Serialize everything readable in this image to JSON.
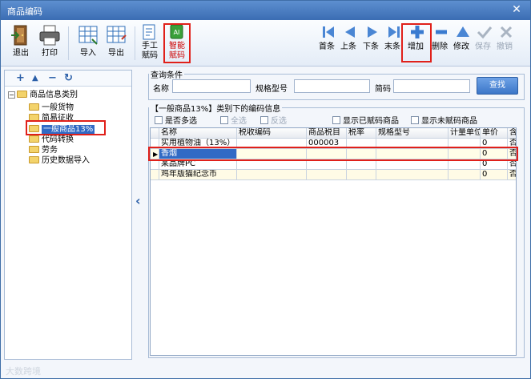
{
  "window": {
    "title": "商品编码",
    "close": "✕"
  },
  "toolbar": {
    "left": [
      {
        "label": "退出",
        "icon": "exit-door-icon"
      },
      {
        "label": "打印",
        "icon": "printer-icon"
      },
      {
        "label": "导入",
        "icon": "import-grid-icon"
      },
      {
        "label": "导出",
        "icon": "export-grid-icon"
      },
      {
        "label": "手工赋码",
        "icon": "manual-code-icon"
      },
      {
        "label": "智能赋码",
        "icon": "smart-code-icon"
      }
    ],
    "right": [
      {
        "label": "首条",
        "icon": "first-record-icon",
        "enabled": true
      },
      {
        "label": "上条",
        "icon": "prev-record-icon",
        "enabled": true
      },
      {
        "label": "下条",
        "icon": "next-record-icon",
        "enabled": true
      },
      {
        "label": "末条",
        "icon": "last-record-icon",
        "enabled": true
      },
      {
        "label": "增加",
        "icon": "plus-icon",
        "enabled": true
      },
      {
        "label": "删除",
        "icon": "minus-icon",
        "enabled": true
      },
      {
        "label": "修改",
        "icon": "triangle-edit-icon",
        "enabled": true
      },
      {
        "label": "保存",
        "icon": "check-icon",
        "enabled": false
      },
      {
        "label": "撤销",
        "icon": "cross-icon",
        "enabled": false
      }
    ]
  },
  "tree": {
    "tools": [
      "+",
      "▲",
      "−",
      "↻"
    ],
    "root": "商品信息类别",
    "items": [
      "一般货物",
      "简易征收",
      "一般商品13%",
      "代码转换",
      "劳务",
      "历史数据导入"
    ],
    "selected": "一般商品13%"
  },
  "query": {
    "legend": "查询条件",
    "name_label": "名称",
    "spec_label": "规格型号",
    "short_label": "简码",
    "name_value": "",
    "spec_value": "",
    "short_value": "",
    "find_button": "查找"
  },
  "list": {
    "legend": "【一般商品13%】类别下的编码信息",
    "options": [
      {
        "label": "是否多选",
        "enabled": true
      },
      {
        "label": "全选",
        "enabled": false
      },
      {
        "label": "反选",
        "enabled": false
      },
      {
        "label": "显示已赋码商品",
        "enabled": true
      },
      {
        "label": "显示未赋码商品",
        "enabled": true
      }
    ]
  },
  "grid": {
    "columns": [
      "名称",
      "税收编码",
      "商品税目",
      "税率",
      "规格型号",
      "计量单位",
      "单价",
      "含"
    ],
    "rows": [
      [
        "实用植物油（13%）",
        "",
        "000003",
        "",
        "",
        "",
        "0",
        "否"
      ],
      [
        "香烟",
        "",
        "",
        "",
        "",
        "",
        "0",
        "否"
      ],
      [
        "某品牌PC",
        "",
        "",
        "",
        "",
        "",
        "0",
        "否"
      ],
      [
        "鸡年版猫纪念币",
        "",
        "",
        "",
        "",
        "",
        "0",
        "否"
      ]
    ]
  },
  "watermark": "大数跨境",
  "colors": {
    "accent": "#3b6db3",
    "highlight_border": "#e0201a",
    "selection": "#316ac5"
  }
}
